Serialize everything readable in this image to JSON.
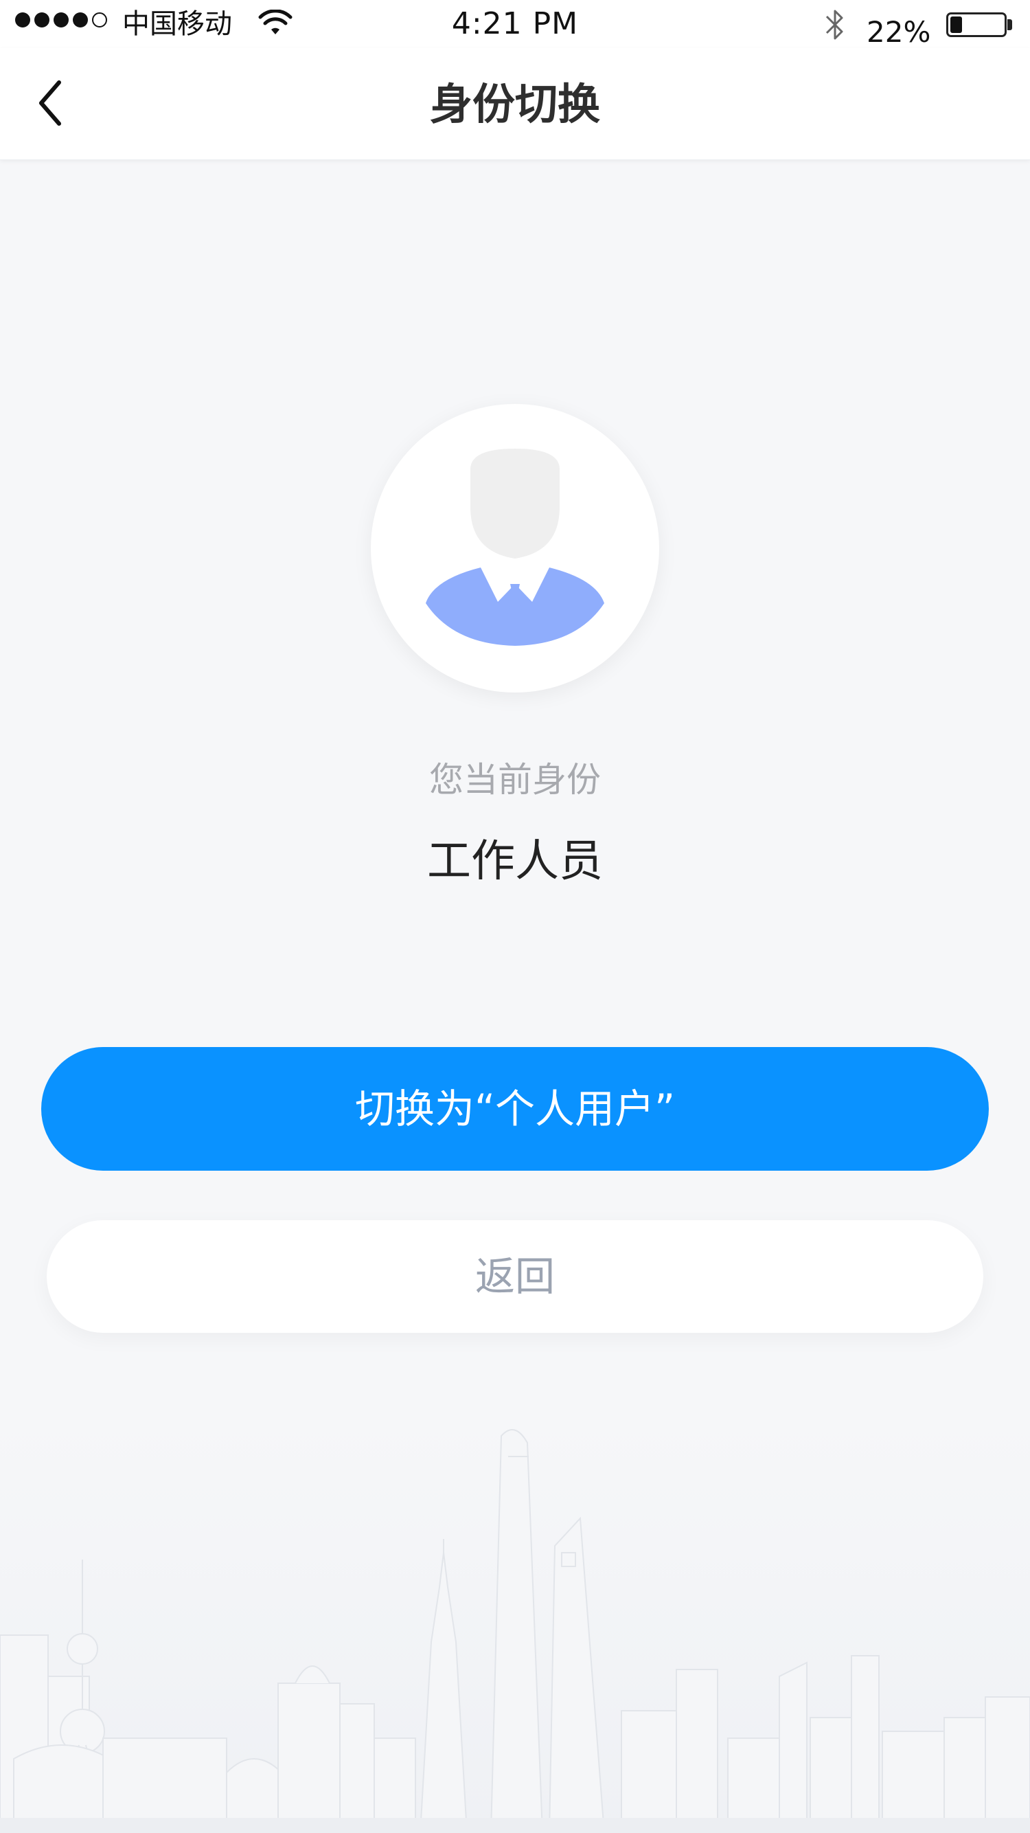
{
  "status_bar": {
    "carrier": "中国移动",
    "time": "4:21 PM",
    "battery_percent": "22%",
    "battery_level": 0.22,
    "signal_bars_filled": 4,
    "signal_bars_total": 5,
    "icons": [
      "wifi-icon",
      "bluetooth-icon",
      "battery-icon"
    ]
  },
  "nav": {
    "title": "身份切换",
    "back_icon": "chevron-left-icon"
  },
  "profile": {
    "avatar_icon": "user-avatar-icon",
    "label": "您当前身份",
    "identity": "工作人员"
  },
  "actions": {
    "switch_label": "切换为“个人用户”",
    "back_label": "返回"
  },
  "colors": {
    "primary": "#0a92ff",
    "background": "#f6f7f9",
    "avatar_tie": "#8fadfc",
    "avatar_face": "#f0f0f0"
  }
}
